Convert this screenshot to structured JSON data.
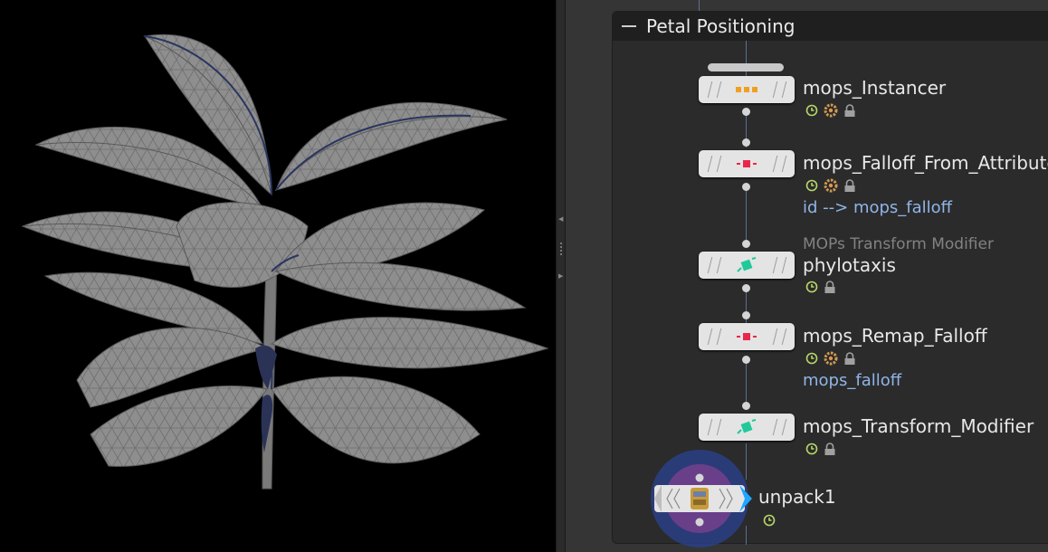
{
  "network": {
    "box_title": "Petal Positioning",
    "nodes": [
      {
        "name": "mops_Instancer",
        "sub": "",
        "expr": "",
        "icon": "orange-dots-icon",
        "flags": [
          "clock-icon",
          "gear-icon",
          "lock-icon"
        ]
      },
      {
        "name": "mops_Falloff_From_Attribute",
        "sub": "",
        "expr": "id --> mops_falloff",
        "icon": "red-falloff-icon",
        "flags": [
          "clock-icon",
          "gear-icon",
          "lock-icon"
        ]
      },
      {
        "name": "phylotaxis",
        "sub": "MOPs Transform Modifier",
        "expr": "",
        "icon": "green-transform-icon",
        "flags": [
          "clock-icon",
          "lock-icon"
        ]
      },
      {
        "name": "mops_Remap_Falloff",
        "sub": "",
        "expr": "mops_falloff",
        "icon": "red-falloff-icon",
        "flags": [
          "clock-icon",
          "gear-icon",
          "lock-icon"
        ]
      },
      {
        "name": "mops_Transform_Modifier",
        "sub": "",
        "expr": "",
        "icon": "green-transform-icon",
        "flags": [
          "clock-icon",
          "lock-icon"
        ]
      },
      {
        "name": "unpack1",
        "sub": "",
        "expr": "",
        "icon": "unpack-icon",
        "flags": [
          "clock-icon"
        ]
      }
    ]
  },
  "colors": {
    "viewport_bg": "#000000",
    "network_bg": "#353535",
    "netbox_bg": "#2b2b2b",
    "expr_text": "#8fb5e8",
    "display_flag": "#1ea7ff",
    "render_ring": "#2a3f86",
    "template_ring": "#6a3f8a"
  }
}
